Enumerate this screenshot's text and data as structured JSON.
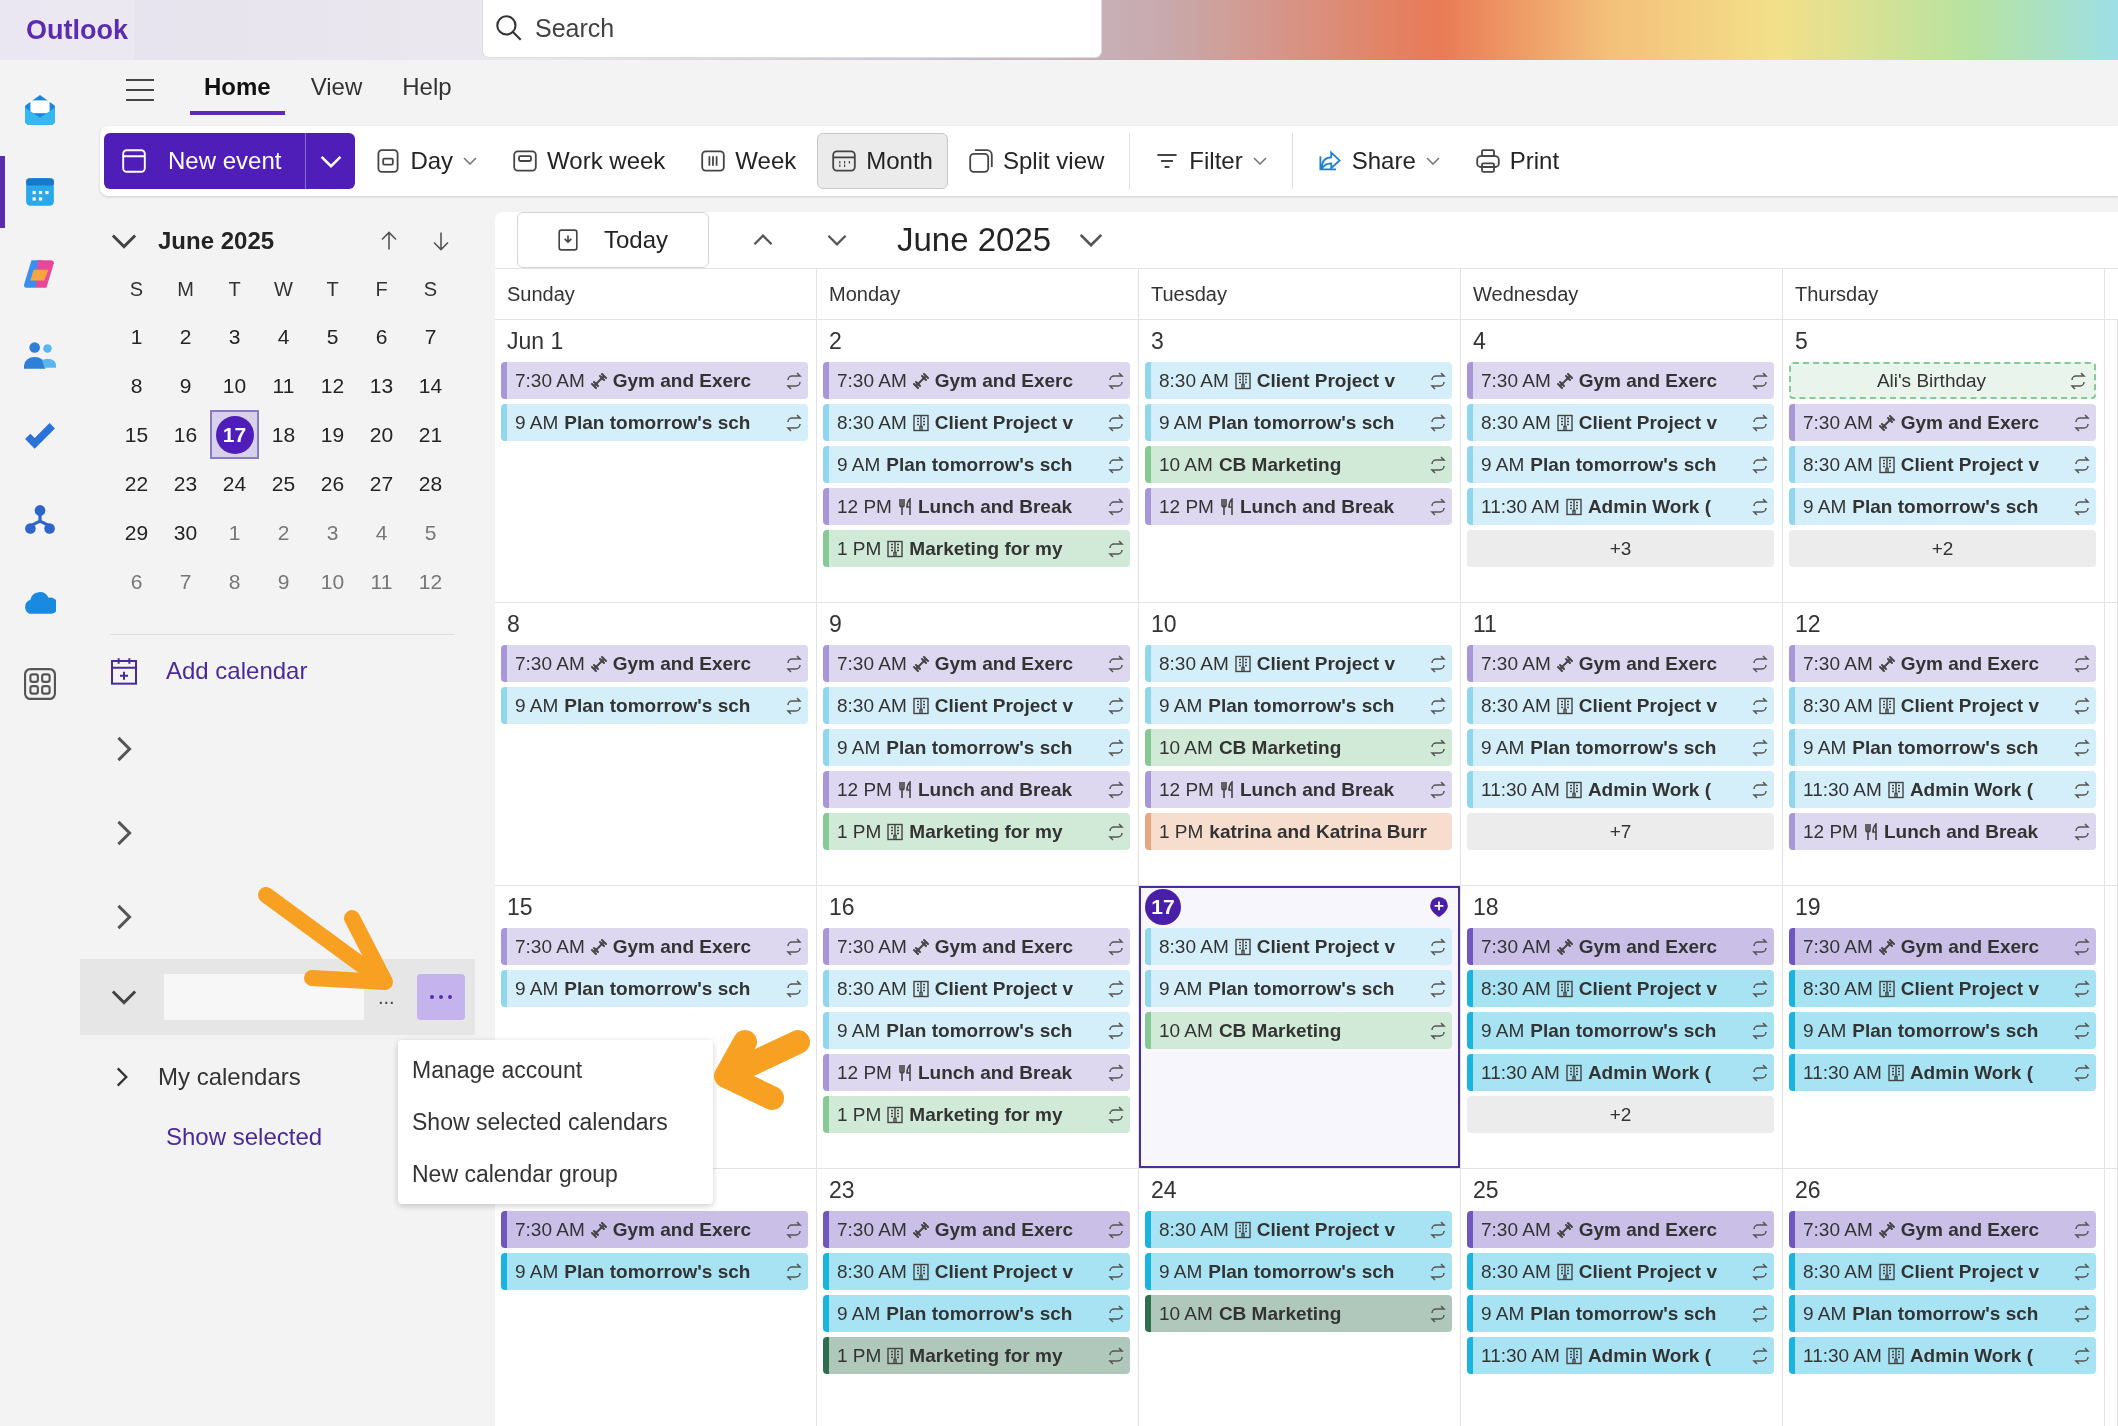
{
  "app": {
    "name": "Outlook"
  },
  "search": {
    "placeholder": "Search"
  },
  "rail": [
    {
      "kind": "mail",
      "selected": false
    },
    {
      "kind": "calendar",
      "selected": true
    },
    {
      "kind": "copilot",
      "selected": false
    },
    {
      "kind": "people",
      "selected": false
    },
    {
      "kind": "todo",
      "selected": false
    },
    {
      "kind": "org",
      "selected": false
    },
    {
      "kind": "cloud",
      "selected": false
    },
    {
      "kind": "apps",
      "selected": false
    }
  ],
  "tabs": [
    {
      "label": "Home",
      "selected": true
    },
    {
      "label": "View",
      "selected": false
    },
    {
      "label": "Help",
      "selected": false
    }
  ],
  "toolbar": {
    "new_event": "New event",
    "items": [
      {
        "kind": "day",
        "label": "Day",
        "dropdown": true,
        "selected": false
      },
      {
        "kind": "workweek",
        "label": "Work week",
        "dropdown": false,
        "selected": false
      },
      {
        "kind": "week",
        "label": "Week",
        "dropdown": false,
        "selected": false
      },
      {
        "kind": "month",
        "label": "Month",
        "dropdown": false,
        "selected": true
      },
      {
        "kind": "split",
        "label": "Split view",
        "dropdown": false,
        "selected": false
      },
      {
        "kind": "divider"
      },
      {
        "kind": "filter",
        "label": "Filter",
        "dropdown": true,
        "selected": false
      },
      {
        "kind": "divider"
      },
      {
        "kind": "share",
        "label": "Share",
        "dropdown": true,
        "selected": false
      },
      {
        "kind": "print",
        "label": "Print",
        "dropdown": false,
        "selected": false
      }
    ]
  },
  "mini_calendar": {
    "title": "June 2025",
    "weekdays": [
      "S",
      "M",
      "T",
      "W",
      "T",
      "F",
      "S"
    ],
    "weeks": [
      [
        {
          "label": "1",
          "outside": false,
          "selected": false
        },
        {
          "label": "2",
          "outside": false,
          "selected": false
        },
        {
          "label": "3",
          "outside": false,
          "selected": false
        },
        {
          "label": "4",
          "outside": false,
          "selected": false
        },
        {
          "label": "5",
          "outside": false,
          "selected": false
        },
        {
          "label": "6",
          "outside": false,
          "selected": false
        },
        {
          "label": "7",
          "outside": false,
          "selected": false
        }
      ],
      [
        {
          "label": "8",
          "outside": false,
          "selected": false
        },
        {
          "label": "9",
          "outside": false,
          "selected": false
        },
        {
          "label": "10",
          "outside": false,
          "selected": false
        },
        {
          "label": "11",
          "outside": false,
          "selected": false
        },
        {
          "label": "12",
          "outside": false,
          "selected": false
        },
        {
          "label": "13",
          "outside": false,
          "selected": false
        },
        {
          "label": "14",
          "outside": false,
          "selected": false
        }
      ],
      [
        {
          "label": "15",
          "outside": false,
          "selected": false
        },
        {
          "label": "16",
          "outside": false,
          "selected": false
        },
        {
          "label": "17",
          "outside": false,
          "selected": true
        },
        {
          "label": "18",
          "outside": false,
          "selected": false
        },
        {
          "label": "19",
          "outside": false,
          "selected": false
        },
        {
          "label": "20",
          "outside": false,
          "selected": false
        },
        {
          "label": "21",
          "outside": false,
          "selected": false
        }
      ],
      [
        {
          "label": "22",
          "outside": false,
          "selected": false
        },
        {
          "label": "23",
          "outside": false,
          "selected": false
        },
        {
          "label": "24",
          "outside": false,
          "selected": false
        },
        {
          "label": "25",
          "outside": false,
          "selected": false
        },
        {
          "label": "26",
          "outside": false,
          "selected": false
        },
        {
          "label": "27",
          "outside": false,
          "selected": false
        },
        {
          "label": "28",
          "outside": false,
          "selected": false
        }
      ],
      [
        {
          "label": "29",
          "outside": false,
          "selected": false
        },
        {
          "label": "30",
          "outside": false,
          "selected": false
        },
        {
          "label": "1",
          "outside": true,
          "selected": false
        },
        {
          "label": "2",
          "outside": true,
          "selected": false
        },
        {
          "label": "3",
          "outside": true,
          "selected": false
        },
        {
          "label": "4",
          "outside": true,
          "selected": false
        },
        {
          "label": "5",
          "outside": true,
          "selected": false
        }
      ],
      [
        {
          "label": "6",
          "outside": true,
          "selected": false
        },
        {
          "label": "7",
          "outside": true,
          "selected": false
        },
        {
          "label": "8",
          "outside": true,
          "selected": false
        },
        {
          "label": "9",
          "outside": true,
          "selected": false
        },
        {
          "label": "10",
          "outside": true,
          "selected": false
        },
        {
          "label": "11",
          "outside": true,
          "selected": false
        },
        {
          "label": "12",
          "outside": true,
          "selected": false
        }
      ]
    ]
  },
  "sidebar": {
    "add_calendar": "Add calendar",
    "groups": [
      {
        "expanded": false
      },
      {
        "expanded": false
      },
      {
        "expanded": false
      }
    ],
    "account": {
      "expanded": true,
      "ellipsis": "...",
      "menu_open": true
    },
    "my_calendars": {
      "label": "My calendars",
      "expanded": false
    },
    "show_selected": "Show selected"
  },
  "menu": {
    "items": [
      "Manage account",
      "Show selected calendars",
      "New calendar group"
    ]
  },
  "calendar": {
    "today_button": "Today",
    "title": "June 2025",
    "weekdays": [
      "Sunday",
      "Monday",
      "Tuesday",
      "Wednesday",
      "Thursday"
    ],
    "weeks": [
      {
        "days": [
          {
            "label": "Jun 1",
            "today": false,
            "events": [
              {
                "kind": "gym",
                "time": "7:30 AM",
                "title": "Gym and Exerc",
                "color": "#a897d8",
                "recurring": true
              },
              {
                "kind": "plain",
                "time": "9 AM",
                "title": "Plan tomorrow's sch",
                "color": "#8fd6ee",
                "recurring": true
              }
            ]
          },
          {
            "label": "2",
            "today": false,
            "events": [
              {
                "kind": "gym",
                "time": "7:30 AM",
                "title": "Gym and Exerc",
                "color": "#a897d8",
                "recurring": true
              },
              {
                "kind": "office",
                "time": "8:30 AM",
                "title": "Client Project v",
                "color": "#8fd6ee",
                "recurring": true
              },
              {
                "kind": "plain",
                "time": "9 AM",
                "title": "Plan tomorrow's sch",
                "color": "#8fd6ee",
                "recurring": true
              },
              {
                "kind": "meal",
                "time": "12 PM",
                "title": "Lunch and Break",
                "color": "#a897d8",
                "recurring": true
              },
              {
                "kind": "office",
                "time": "1 PM",
                "title": "Marketing for my",
                "color": "#87c995",
                "recurring": true
              }
            ]
          },
          {
            "label": "3",
            "today": false,
            "events": [
              {
                "kind": "office",
                "time": "8:30 AM",
                "title": "Client Project v",
                "color": "#8fd6ee",
                "recurring": true
              },
              {
                "kind": "plain",
                "time": "9 AM",
                "title": "Plan tomorrow's sch",
                "color": "#8fd6ee",
                "recurring": true
              },
              {
                "kind": "plain",
                "time": "10 AM",
                "title": "CB Marketing",
                "color": "#87c995",
                "recurring": true
              },
              {
                "kind": "meal",
                "time": "12 PM",
                "title": "Lunch and Break",
                "color": "#a897d8",
                "recurring": true
              }
            ]
          },
          {
            "label": "4",
            "today": false,
            "more": "+3",
            "events": [
              {
                "kind": "gym",
                "time": "7:30 AM",
                "title": "Gym and Exerc",
                "color": "#a897d8",
                "recurring": true
              },
              {
                "kind": "office",
                "time": "8:30 AM",
                "title": "Client Project v",
                "color": "#8fd6ee",
                "recurring": true
              },
              {
                "kind": "plain",
                "time": "9 AM",
                "title": "Plan tomorrow's sch",
                "color": "#8fd6ee",
                "recurring": true
              },
              {
                "kind": "office",
                "time": "11:30 AM",
                "title": "Admin Work (",
                "color": "#8fd6ee",
                "recurring": true
              }
            ]
          },
          {
            "label": "5",
            "today": false,
            "more": "+2",
            "events": [
              {
                "kind": "allday",
                "title": "Ali's Birthday",
                "color": "#87c995",
                "recurring": true
              },
              {
                "kind": "gym",
                "time": "7:30 AM",
                "title": "Gym and Exerc",
                "color": "#a897d8",
                "recurring": true
              },
              {
                "kind": "office",
                "time": "8:30 AM",
                "title": "Client Project v",
                "color": "#8fd6ee",
                "recurring": true
              },
              {
                "kind": "plain",
                "time": "9 AM",
                "title": "Plan tomorrow's sch",
                "color": "#8fd6ee",
                "recurring": true
              }
            ]
          }
        ]
      },
      {
        "days": [
          {
            "label": "8",
            "today": false,
            "events": [
              {
                "kind": "gym",
                "time": "7:30 AM",
                "title": "Gym and Exerc",
                "color": "#a897d8",
                "recurring": true
              },
              {
                "kind": "plain",
                "time": "9 AM",
                "title": "Plan tomorrow's sch",
                "color": "#8fd6ee",
                "recurring": true
              }
            ]
          },
          {
            "label": "9",
            "today": false,
            "events": [
              {
                "kind": "gym",
                "time": "7:30 AM",
                "title": "Gym and Exerc",
                "color": "#a897d8",
                "recurring": true
              },
              {
                "kind": "office",
                "time": "8:30 AM",
                "title": "Client Project v",
                "color": "#8fd6ee",
                "recurring": true
              },
              {
                "kind": "plain",
                "time": "9 AM",
                "title": "Plan tomorrow's sch",
                "color": "#8fd6ee",
                "recurring": true
              },
              {
                "kind": "meal",
                "time": "12 PM",
                "title": "Lunch and Break",
                "color": "#a897d8",
                "recurring": true
              },
              {
                "kind": "office",
                "time": "1 PM",
                "title": "Marketing for my",
                "color": "#87c995",
                "recurring": true
              }
            ]
          },
          {
            "label": "10",
            "today": false,
            "events": [
              {
                "kind": "office",
                "time": "8:30 AM",
                "title": "Client Project v",
                "color": "#8fd6ee",
                "recurring": true
              },
              {
                "kind": "plain",
                "time": "9 AM",
                "title": "Plan tomorrow's sch",
                "color": "#8fd6ee",
                "recurring": true
              },
              {
                "kind": "plain",
                "time": "10 AM",
                "title": "CB Marketing",
                "color": "#87c995",
                "recurring": true
              },
              {
                "kind": "meal",
                "time": "12 PM",
                "title": "Lunch and Break",
                "color": "#a897d8",
                "recurring": true
              },
              {
                "kind": "plain",
                "time": "1 PM",
                "title": "katrina and Katrina Burr",
                "color": "#e7a67e",
                "recurring": false
              }
            ]
          },
          {
            "label": "11",
            "today": false,
            "more": "+7",
            "events": [
              {
                "kind": "gym",
                "time": "7:30 AM",
                "title": "Gym and Exerc",
                "color": "#a897d8",
                "recurring": true
              },
              {
                "kind": "office",
                "time": "8:30 AM",
                "title": "Client Project v",
                "color": "#8fd6ee",
                "recurring": true
              },
              {
                "kind": "plain",
                "time": "9 AM",
                "title": "Plan tomorrow's sch",
                "color": "#8fd6ee",
                "recurring": true
              },
              {
                "kind": "office",
                "time": "11:30 AM",
                "title": "Admin Work (",
                "color": "#8fd6ee",
                "recurring": true
              }
            ]
          },
          {
            "label": "12",
            "today": false,
            "events": [
              {
                "kind": "gym",
                "time": "7:30 AM",
                "title": "Gym and Exerc",
                "color": "#a897d8",
                "recurring": true
              },
              {
                "kind": "office",
                "time": "8:30 AM",
                "title": "Client Project v",
                "color": "#8fd6ee",
                "recurring": true
              },
              {
                "kind": "plain",
                "time": "9 AM",
                "title": "Plan tomorrow's sch",
                "color": "#8fd6ee",
                "recurring": true
              },
              {
                "kind": "office",
                "time": "11:30 AM",
                "title": "Admin Work (",
                "color": "#8fd6ee",
                "recurring": true
              },
              {
                "kind": "meal",
                "time": "12 PM",
                "title": "Lunch and Break",
                "color": "#a897d8",
                "recurring": true
              }
            ]
          }
        ]
      },
      {
        "days": [
          {
            "label": "15",
            "today": false,
            "events": [
              {
                "kind": "gym",
                "time": "7:30 AM",
                "title": "Gym and Exerc",
                "color": "#a897d8",
                "recurring": true
              },
              {
                "kind": "plain",
                "time": "9 AM",
                "title": "Plan tomorrow's sch",
                "color": "#8fd6ee",
                "recurring": true
              }
            ]
          },
          {
            "label": "16",
            "today": false,
            "events": [
              {
                "kind": "gym",
                "time": "7:30 AM",
                "title": "Gym and Exerc",
                "color": "#a897d8",
                "recurring": true
              },
              {
                "kind": "office",
                "time": "8:30 AM",
                "title": "Client Project v",
                "color": "#8fd6ee",
                "recurring": true
              },
              {
                "kind": "plain",
                "time": "9 AM",
                "title": "Plan tomorrow's sch",
                "color": "#8fd6ee",
                "recurring": true
              },
              {
                "kind": "meal",
                "time": "12 PM",
                "title": "Lunch and Break",
                "color": "#a897d8",
                "recurring": true
              },
              {
                "kind": "office",
                "time": "1 PM",
                "title": "Marketing for my",
                "color": "#87c995",
                "recurring": true
              }
            ]
          },
          {
            "label": "17",
            "today": true,
            "events": [
              {
                "kind": "office",
                "time": "8:30 AM",
                "title": "Client Project v",
                "color": "#8fd6ee",
                "recurring": true
              },
              {
                "kind": "plain",
                "time": "9 AM",
                "title": "Plan tomorrow's sch",
                "color": "#8fd6ee",
                "recurring": true
              },
              {
                "kind": "plain",
                "time": "10 AM",
                "title": "CB Marketing",
                "color": "#87c995",
                "recurring": true
              }
            ]
          },
          {
            "label": "18",
            "today": false,
            "more": "+2",
            "events": [
              {
                "kind": "gym",
                "time": "7:30 AM",
                "title": "Gym and Exerc",
                "color": "#7057c0",
                "recurring": true
              },
              {
                "kind": "office",
                "time": "8:30 AM",
                "title": "Client Project v",
                "color": "#19b4e0",
                "recurring": true
              },
              {
                "kind": "plain",
                "time": "9 AM",
                "title": "Plan tomorrow's sch",
                "color": "#19b4e0",
                "recurring": true
              },
              {
                "kind": "office",
                "time": "11:30 AM",
                "title": "Admin Work (",
                "color": "#19b4e0",
                "recurring": true
              }
            ]
          },
          {
            "label": "19",
            "today": false,
            "events": [
              {
                "kind": "gym",
                "time": "7:30 AM",
                "title": "Gym and Exerc",
                "color": "#7057c0",
                "recurring": true
              },
              {
                "kind": "office",
                "time": "8:30 AM",
                "title": "Client Project v",
                "color": "#19b4e0",
                "recurring": true
              },
              {
                "kind": "plain",
                "time": "9 AM",
                "title": "Plan tomorrow's sch",
                "color": "#19b4e0",
                "recurring": true
              },
              {
                "kind": "office",
                "time": "11:30 AM",
                "title": "Admin Work (",
                "color": "#19b4e0",
                "recurring": true
              }
            ]
          }
        ]
      },
      {
        "days": [
          {
            "today": false,
            "events": [
              {
                "kind": "gym",
                "time": "7:30 AM",
                "title": "Gym and Exerc",
                "color": "#7057c0",
                "recurring": true
              },
              {
                "kind": "plain",
                "time": "9 AM",
                "title": "Plan tomorrow's sch",
                "color": "#19b4e0",
                "recurring": true
              }
            ]
          },
          {
            "label": "23",
            "today": false,
            "events": [
              {
                "kind": "gym",
                "time": "7:30 AM",
                "title": "Gym and Exerc",
                "color": "#7057c0",
                "recurring": true
              },
              {
                "kind": "office",
                "time": "8:30 AM",
                "title": "Client Project v",
                "color": "#19b4e0",
                "recurring": true
              },
              {
                "kind": "plain",
                "time": "9 AM",
                "title": "Plan tomorrow's sch",
                "color": "#19b4e0",
                "recurring": true
              },
              {
                "kind": "office",
                "time": "1 PM",
                "title": "Marketing for my",
                "color": "#2f6e4e",
                "recurring": true
              }
            ]
          },
          {
            "label": "24",
            "today": false,
            "events": [
              {
                "kind": "office",
                "time": "8:30 AM",
                "title": "Client Project v",
                "color": "#19b4e0",
                "recurring": true
              },
              {
                "kind": "plain",
                "time": "9 AM",
                "title": "Plan tomorrow's sch",
                "color": "#19b4e0",
                "recurring": true
              },
              {
                "kind": "plain",
                "time": "10 AM",
                "title": "CB Marketing",
                "color": "#2f6e4e",
                "recurring": true
              }
            ]
          },
          {
            "label": "25",
            "today": false,
            "events": [
              {
                "kind": "gym",
                "time": "7:30 AM",
                "title": "Gym and Exerc",
                "color": "#7057c0",
                "recurring": true
              },
              {
                "kind": "office",
                "time": "8:30 AM",
                "title": "Client Project v",
                "color": "#19b4e0",
                "recurring": true
              },
              {
                "kind": "plain",
                "time": "9 AM",
                "title": "Plan tomorrow's sch",
                "color": "#19b4e0",
                "recurring": true
              },
              {
                "kind": "office",
                "time": "11:30 AM",
                "title": "Admin Work (",
                "color": "#19b4e0",
                "recurring": true
              }
            ]
          },
          {
            "label": "26",
            "today": false,
            "events": [
              {
                "kind": "gym",
                "time": "7:30 AM",
                "title": "Gym and Exerc",
                "color": "#7057c0",
                "recurring": true
              },
              {
                "kind": "office",
                "time": "8:30 AM",
                "title": "Client Project v",
                "color": "#19b4e0",
                "recurring": true
              },
              {
                "kind": "plain",
                "time": "9 AM",
                "title": "Plan tomorrow's sch",
                "color": "#19b4e0",
                "recurring": true
              },
              {
                "kind": "office",
                "time": "11:30 AM",
                "title": "Admin Work (",
                "color": "#19b4e0",
                "recurring": true
              }
            ]
          }
        ]
      }
    ]
  }
}
